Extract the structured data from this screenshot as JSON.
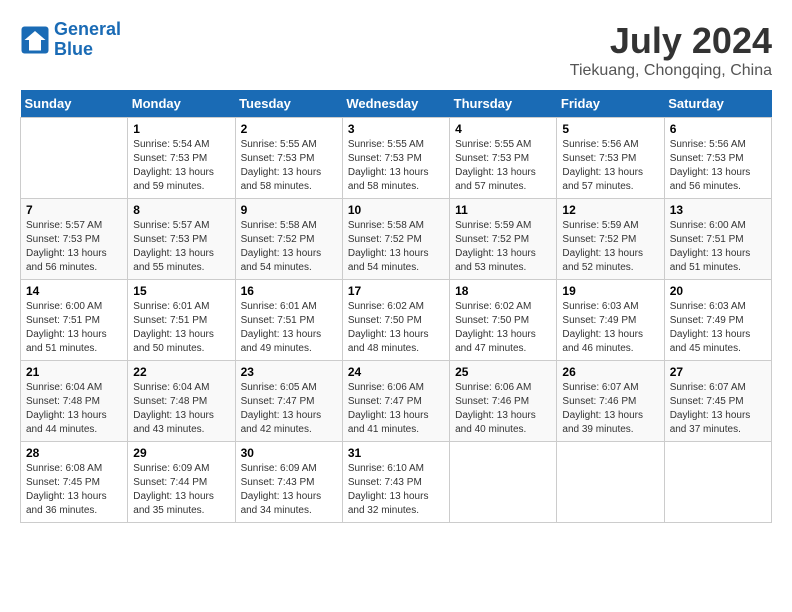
{
  "header": {
    "logo_line1": "General",
    "logo_line2": "Blue",
    "title": "July 2024",
    "subtitle": "Tiekuang, Chongqing, China"
  },
  "calendar": {
    "headers": [
      "Sunday",
      "Monday",
      "Tuesday",
      "Wednesday",
      "Thursday",
      "Friday",
      "Saturday"
    ],
    "weeks": [
      [
        {
          "day": "",
          "info": ""
        },
        {
          "day": "1",
          "info": "Sunrise: 5:54 AM\nSunset: 7:53 PM\nDaylight: 13 hours\nand 59 minutes."
        },
        {
          "day": "2",
          "info": "Sunrise: 5:55 AM\nSunset: 7:53 PM\nDaylight: 13 hours\nand 58 minutes."
        },
        {
          "day": "3",
          "info": "Sunrise: 5:55 AM\nSunset: 7:53 PM\nDaylight: 13 hours\nand 58 minutes."
        },
        {
          "day": "4",
          "info": "Sunrise: 5:55 AM\nSunset: 7:53 PM\nDaylight: 13 hours\nand 57 minutes."
        },
        {
          "day": "5",
          "info": "Sunrise: 5:56 AM\nSunset: 7:53 PM\nDaylight: 13 hours\nand 57 minutes."
        },
        {
          "day": "6",
          "info": "Sunrise: 5:56 AM\nSunset: 7:53 PM\nDaylight: 13 hours\nand 56 minutes."
        }
      ],
      [
        {
          "day": "7",
          "info": "Sunrise: 5:57 AM\nSunset: 7:53 PM\nDaylight: 13 hours\nand 56 minutes."
        },
        {
          "day": "8",
          "info": "Sunrise: 5:57 AM\nSunset: 7:53 PM\nDaylight: 13 hours\nand 55 minutes."
        },
        {
          "day": "9",
          "info": "Sunrise: 5:58 AM\nSunset: 7:52 PM\nDaylight: 13 hours\nand 54 minutes."
        },
        {
          "day": "10",
          "info": "Sunrise: 5:58 AM\nSunset: 7:52 PM\nDaylight: 13 hours\nand 54 minutes."
        },
        {
          "day": "11",
          "info": "Sunrise: 5:59 AM\nSunset: 7:52 PM\nDaylight: 13 hours\nand 53 minutes."
        },
        {
          "day": "12",
          "info": "Sunrise: 5:59 AM\nSunset: 7:52 PM\nDaylight: 13 hours\nand 52 minutes."
        },
        {
          "day": "13",
          "info": "Sunrise: 6:00 AM\nSunset: 7:51 PM\nDaylight: 13 hours\nand 51 minutes."
        }
      ],
      [
        {
          "day": "14",
          "info": "Sunrise: 6:00 AM\nSunset: 7:51 PM\nDaylight: 13 hours\nand 51 minutes."
        },
        {
          "day": "15",
          "info": "Sunrise: 6:01 AM\nSunset: 7:51 PM\nDaylight: 13 hours\nand 50 minutes."
        },
        {
          "day": "16",
          "info": "Sunrise: 6:01 AM\nSunset: 7:51 PM\nDaylight: 13 hours\nand 49 minutes."
        },
        {
          "day": "17",
          "info": "Sunrise: 6:02 AM\nSunset: 7:50 PM\nDaylight: 13 hours\nand 48 minutes."
        },
        {
          "day": "18",
          "info": "Sunrise: 6:02 AM\nSunset: 7:50 PM\nDaylight: 13 hours\nand 47 minutes."
        },
        {
          "day": "19",
          "info": "Sunrise: 6:03 AM\nSunset: 7:49 PM\nDaylight: 13 hours\nand 46 minutes."
        },
        {
          "day": "20",
          "info": "Sunrise: 6:03 AM\nSunset: 7:49 PM\nDaylight: 13 hours\nand 45 minutes."
        }
      ],
      [
        {
          "day": "21",
          "info": "Sunrise: 6:04 AM\nSunset: 7:48 PM\nDaylight: 13 hours\nand 44 minutes."
        },
        {
          "day": "22",
          "info": "Sunrise: 6:04 AM\nSunset: 7:48 PM\nDaylight: 13 hours\nand 43 minutes."
        },
        {
          "day": "23",
          "info": "Sunrise: 6:05 AM\nSunset: 7:47 PM\nDaylight: 13 hours\nand 42 minutes."
        },
        {
          "day": "24",
          "info": "Sunrise: 6:06 AM\nSunset: 7:47 PM\nDaylight: 13 hours\nand 41 minutes."
        },
        {
          "day": "25",
          "info": "Sunrise: 6:06 AM\nSunset: 7:46 PM\nDaylight: 13 hours\nand 40 minutes."
        },
        {
          "day": "26",
          "info": "Sunrise: 6:07 AM\nSunset: 7:46 PM\nDaylight: 13 hours\nand 39 minutes."
        },
        {
          "day": "27",
          "info": "Sunrise: 6:07 AM\nSunset: 7:45 PM\nDaylight: 13 hours\nand 37 minutes."
        }
      ],
      [
        {
          "day": "28",
          "info": "Sunrise: 6:08 AM\nSunset: 7:45 PM\nDaylight: 13 hours\nand 36 minutes."
        },
        {
          "day": "29",
          "info": "Sunrise: 6:09 AM\nSunset: 7:44 PM\nDaylight: 13 hours\nand 35 minutes."
        },
        {
          "day": "30",
          "info": "Sunrise: 6:09 AM\nSunset: 7:43 PM\nDaylight: 13 hours\nand 34 minutes."
        },
        {
          "day": "31",
          "info": "Sunrise: 6:10 AM\nSunset: 7:43 PM\nDaylight: 13 hours\nand 32 minutes."
        },
        {
          "day": "",
          "info": ""
        },
        {
          "day": "",
          "info": ""
        },
        {
          "day": "",
          "info": ""
        }
      ]
    ]
  }
}
